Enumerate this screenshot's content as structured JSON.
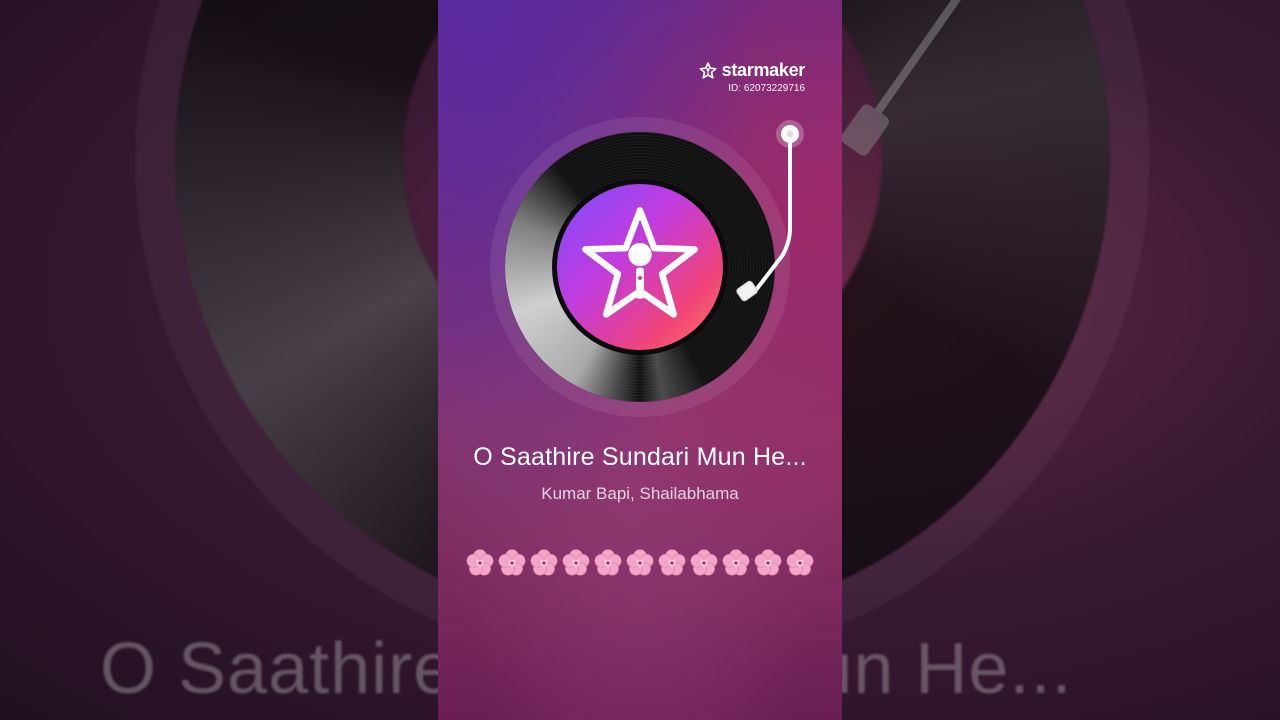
{
  "background": {
    "title": "O Saathire Sundari Mun He..."
  },
  "brand": {
    "name": "starmaker",
    "id_text": "ID: 62073229716"
  },
  "song": {
    "title": "O Saathire Sundari Mun He...",
    "artist": "Kumar Bapi, Shailabhama"
  },
  "decorations": {
    "flower_count": 11,
    "flower_icon": "cherry-blossom-icon"
  },
  "colors": {
    "label_gradient": [
      "#7a4cff",
      "#c13ce0",
      "#f0437a",
      "#ff7a5a"
    ],
    "flower_pink": "#f4a6c8"
  }
}
